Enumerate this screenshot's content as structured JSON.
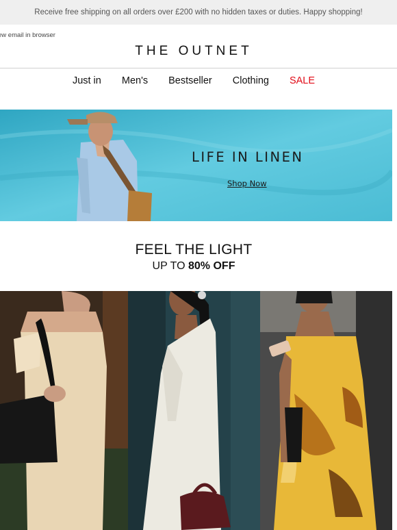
{
  "topbar": {
    "text": "Receive free shipping on all orders over £200 with no hidden taxes or duties. Happy shopping!"
  },
  "header": {
    "view_in_browser": "ew email in browser",
    "logo": "THE OUTNET"
  },
  "nav": {
    "items": [
      {
        "label": "Just in"
      },
      {
        "label": "Men's"
      },
      {
        "label": "Bestseller"
      },
      {
        "label": "Clothing"
      },
      {
        "label": "SALE",
        "color": "#e10b17"
      }
    ]
  },
  "hero": {
    "title": "LIFE IN LINEN",
    "cta": "Shop Now"
  },
  "promo": {
    "title": "FEEL THE LIGHT",
    "sub_prefix": "UP TO ",
    "sub_bold": "80% OFF"
  },
  "colors": {
    "hero_blue": "#59c4db",
    "sale_red": "#e10b17",
    "topbar_bg": "#efefef"
  }
}
